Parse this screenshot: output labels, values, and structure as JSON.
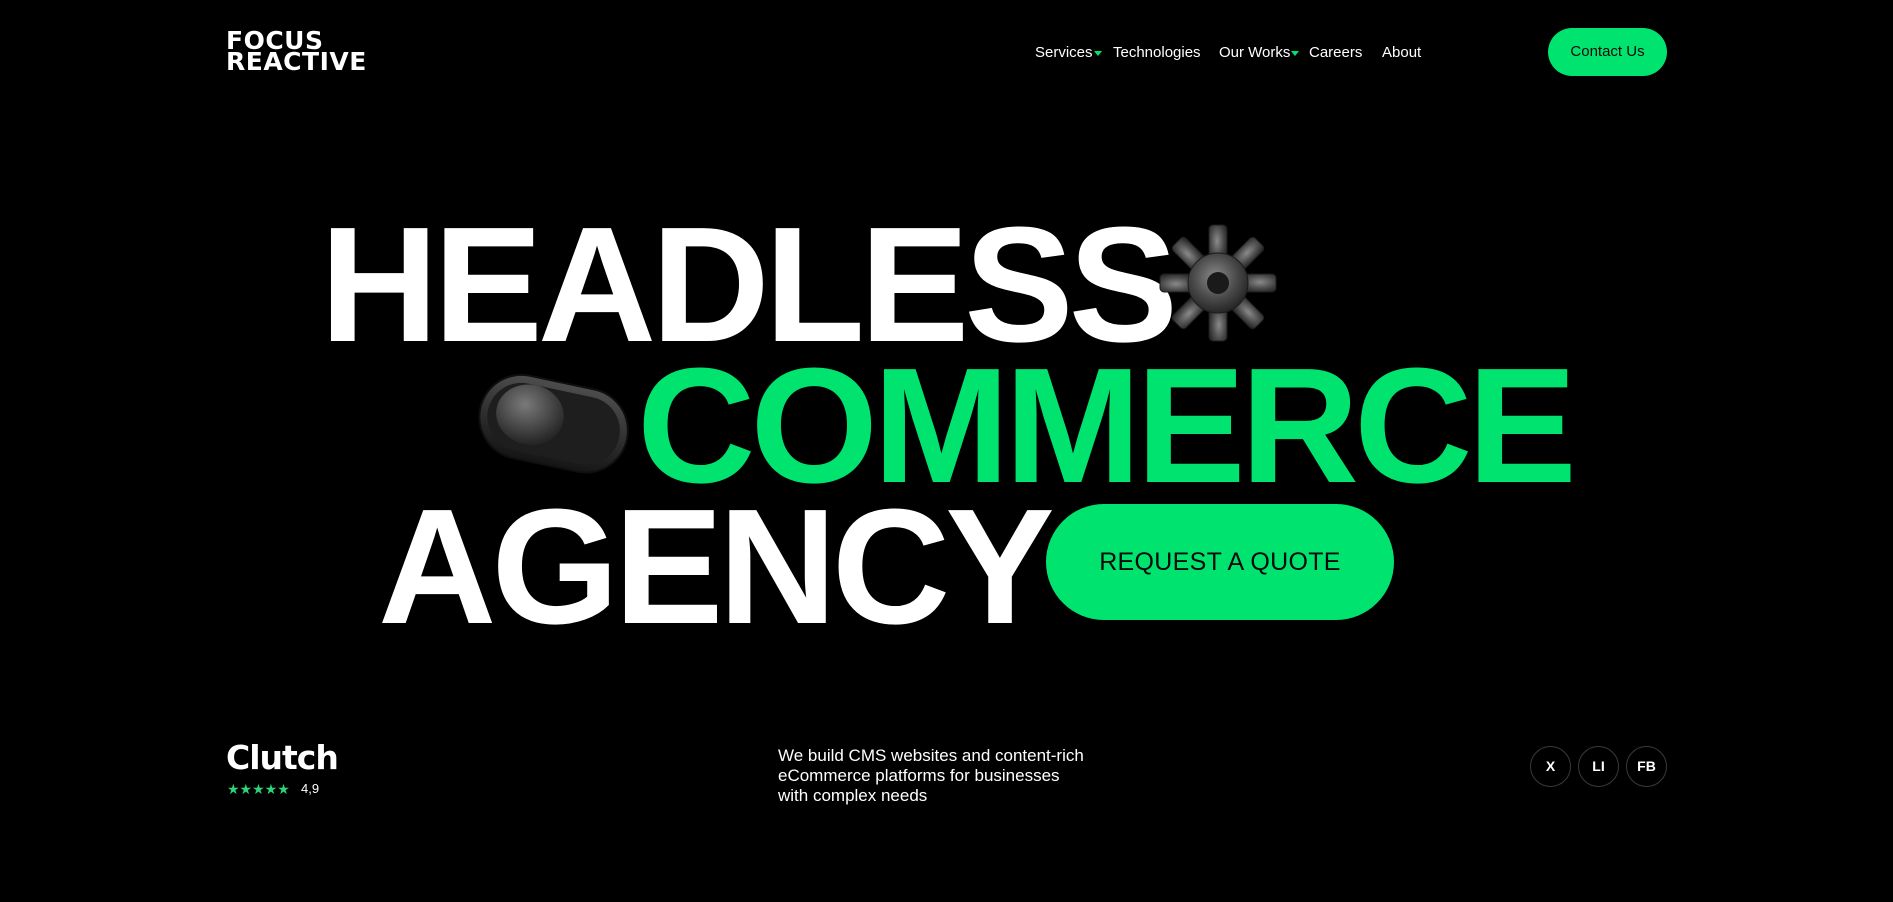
{
  "brand": {
    "line1": "FOCUS",
    "line2": "REACTIVE"
  },
  "nav": {
    "items": [
      {
        "label": "Services",
        "has_dropdown": true
      },
      {
        "label": "Technologies",
        "has_dropdown": false
      },
      {
        "label": "Our Works",
        "has_dropdown": true
      },
      {
        "label": "Careers",
        "has_dropdown": false
      },
      {
        "label": "About",
        "has_dropdown": false
      }
    ],
    "contact_label": "Contact Us"
  },
  "hero": {
    "line1": "HEADLESS",
    "line2": "COMMERCE",
    "line3": "AGENCY",
    "cta_label": "REQUEST A QUOTE",
    "decorations": [
      "gear-icon",
      "toggle-switch-icon"
    ]
  },
  "clutch": {
    "name": "Clutch",
    "stars": "★★★★★",
    "rating": "4,9"
  },
  "description": {
    "lines": [
      "We build CMS websites and content-rich",
      "eCommerce platforms for businesses",
      "with complex needs"
    ]
  },
  "social": [
    {
      "label": "X",
      "icon": "x-icon"
    },
    {
      "label": "LI",
      "icon": "linkedin-icon"
    },
    {
      "label": "FB",
      "icon": "facebook-icon"
    }
  ],
  "colors": {
    "background": "#000000",
    "accent": "#00e46f",
    "text": "#ffffff"
  }
}
